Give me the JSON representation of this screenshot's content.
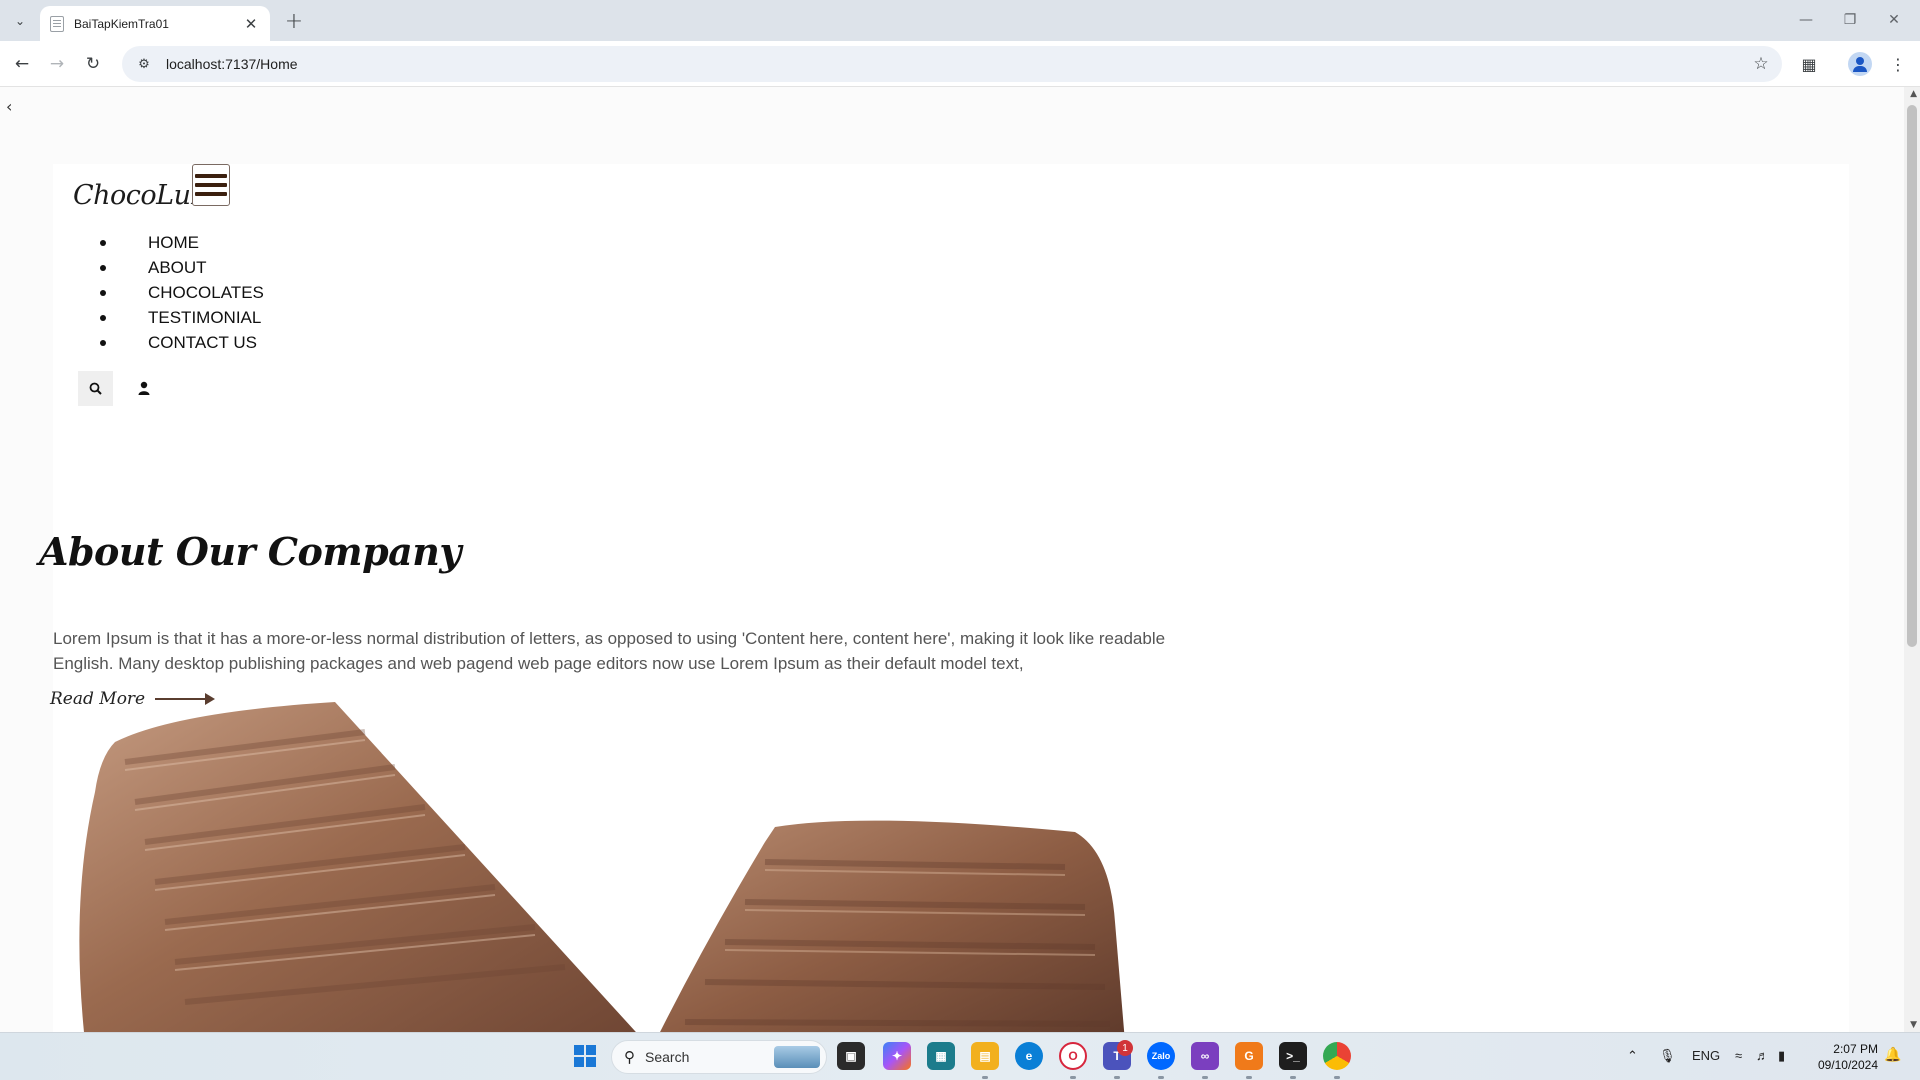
{
  "browser": {
    "tab_title": "BaiTapKiemTra01",
    "url": "localhost:7137/Home"
  },
  "site": {
    "brand": "ChocoLux",
    "nav": [
      {
        "label": "HOME"
      },
      {
        "label": "ABOUT"
      },
      {
        "label": "CHOCOLATES"
      },
      {
        "label": "TESTIMONIAL"
      },
      {
        "label": "CONTACT US"
      }
    ],
    "about": {
      "title": "About Our Company",
      "text": "Lorem Ipsum is that it has a more-or-less normal distribution of letters, as opposed to using 'Content here, content here', making it look like readable English. Many desktop publishing packages and web pagend web page editors now use Lorem Ipsum as their default model text,",
      "read_more": "Read More"
    },
    "colors": {
      "chocolate_dark": "#5a3d2f",
      "chocolate_mid": "#9a6a4f",
      "chocolate_light": "#c49a80"
    }
  },
  "taskbar": {
    "search_placeholder": "Search",
    "notification_count": "1",
    "language": "ENG",
    "time": "2:07 PM",
    "date": "09/10/2024"
  }
}
